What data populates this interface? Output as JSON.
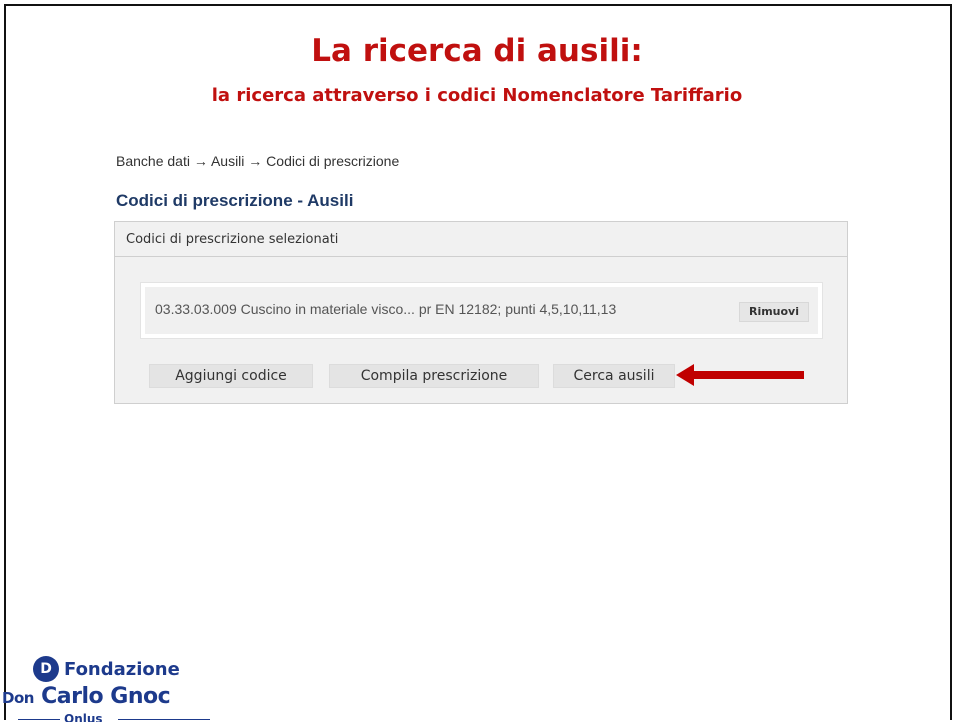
{
  "slide": {
    "title": "La ricerca di ausili:",
    "subtitle": "la ricerca attraverso i codici Nomenclatore Tariffario"
  },
  "breadcrumb": "Banche dati → Ausili → Codici di prescrizione",
  "page_heading": "Codici di prescrizione - Ausili",
  "panel": {
    "header": "Codici di prescrizione selezionati",
    "code_text": "03.33.03.009 Cuscino in materiale visco... pr EN 12182; punti 4,5,10,11,13",
    "remove_label": "Rimuovi",
    "buttons": {
      "add": "Aggiungi codice",
      "compile": "Compila prescrizione",
      "search": "Cerca ausili"
    }
  },
  "annotation": {
    "arrow_color": "#c00000",
    "arrow_icon": "arrow-left-icon"
  },
  "logo": {
    "mark": "D",
    "line1": "Fondazione",
    "line2_prefix": "Don",
    "line2_name": "Carlo Gnoc",
    "line3": "Onlus"
  },
  "colors": {
    "title": "#c0100f",
    "heading": "#1f3a66",
    "logo": "#1d3a8c"
  }
}
